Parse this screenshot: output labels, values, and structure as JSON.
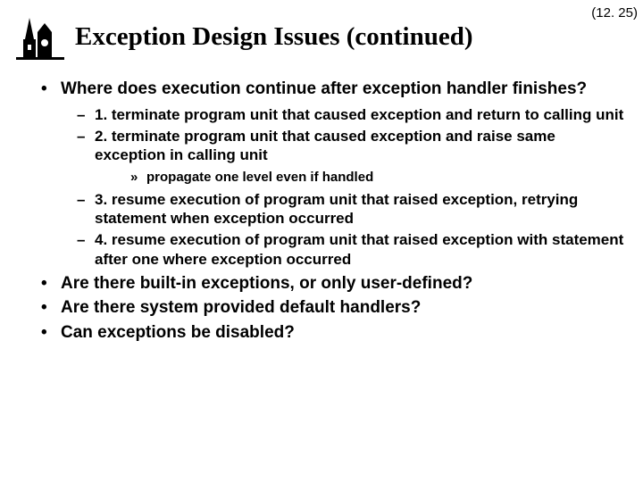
{
  "page_number": "(12. 25)",
  "title": "Exception Design Issues (continued)",
  "bullets": [
    {
      "text": "Where does execution continue after exception handler finishes?",
      "sub": [
        {
          "text": "1.  terminate program unit that caused exception and return to calling unit"
        },
        {
          "text": "2.  terminate program unit that caused exception and raise same exception in calling unit",
          "subsub": [
            {
              "text": "propagate one level even if handled"
            }
          ]
        },
        {
          "text": "3.  resume execution of program unit that raised exception, retrying statement when exception occurred"
        },
        {
          "text": "4.  resume execution of program unit that raised exception with statement after one where exception occurred"
        }
      ]
    },
    {
      "text": "Are there built-in exceptions, or only user-defined?"
    },
    {
      "text": "Are there system provided default handlers?"
    },
    {
      "text": "Can exceptions be disabled?"
    }
  ]
}
